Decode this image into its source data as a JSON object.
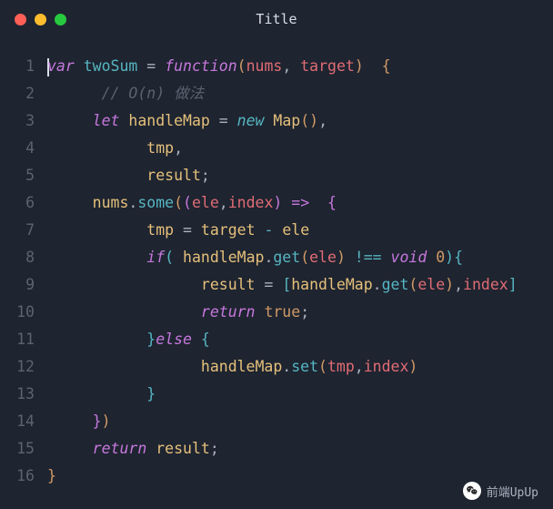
{
  "window": {
    "title": "Title"
  },
  "code": {
    "lines": [
      {
        "n": "1"
      },
      {
        "n": "2"
      },
      {
        "n": "3"
      },
      {
        "n": "4"
      },
      {
        "n": "5"
      },
      {
        "n": "6"
      },
      {
        "n": "7"
      },
      {
        "n": "8"
      },
      {
        "n": "9"
      },
      {
        "n": "10"
      },
      {
        "n": "11"
      },
      {
        "n": "12"
      },
      {
        "n": "13"
      },
      {
        "n": "14"
      },
      {
        "n": "15"
      },
      {
        "n": "16"
      }
    ],
    "tokens": {
      "var": "var",
      "twoSum": "twoSum",
      "eq": " = ",
      "function": "function",
      "nums": "nums",
      "comma": ",",
      "space": " ",
      "target": "target",
      "lbrace": "{",
      "rbrace": "}",
      "lparen": "(",
      "rparen": ")",
      "comment": "// O(n) 做法",
      "let": "let",
      "handleMap": "handleMap",
      "new": "new",
      "Map": "Map",
      "tmp": "tmp",
      "result": "result",
      "semi": ";",
      "dot": ".",
      "some": "some",
      "ele": "ele",
      "index": "index",
      "arrow": "=>",
      "minus": " - ",
      "if": "if",
      "get": "get",
      "neq": " !== ",
      "void": "void",
      "zero": "0",
      "lbracket": "[",
      "rbracket": "]",
      "return": "return",
      "true": "true",
      "else": "else",
      "set": "set"
    }
  },
  "watermark": {
    "text": "前端UpUp"
  }
}
